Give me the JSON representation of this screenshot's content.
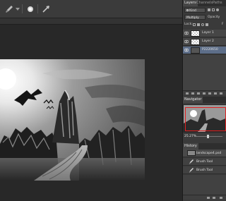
{
  "options_bar": {
    "tools": [
      "brush-tool-icon",
      "brush-preset-picker-icon",
      "airbrush-icon",
      "pressure-icon"
    ]
  },
  "panels": {
    "layers_tabs": [
      "Layers",
      "Channels",
      "Paths"
    ],
    "layers_active_tab": "Layers",
    "filter_kind": "Kind",
    "blend_mode": "Multiply",
    "opacity_label": "Opacity",
    "lock_label": "Lock:",
    "fill_label": "F",
    "layers": [
      {
        "name": "Layer 1",
        "selected": false,
        "visible": true
      },
      {
        "name": "Layer 2",
        "selected": false,
        "visible": true
      },
      {
        "name": "P2220650",
        "selected": true,
        "visible": true
      }
    ],
    "navigator_tab": "Navigator",
    "zoom": "25.27%",
    "history_tab": "History",
    "history": [
      {
        "label": "landscape4.psd",
        "kind": "snapshot"
      },
      {
        "label": "Brush Tool",
        "kind": "step"
      },
      {
        "label": "Brush Tool",
        "kind": "step"
      }
    ]
  },
  "colors": {
    "workspace": "#282828",
    "panel": "#3a3a3a",
    "selected_layer": "#5d6e89",
    "navigator_frame": "#e02020"
  }
}
